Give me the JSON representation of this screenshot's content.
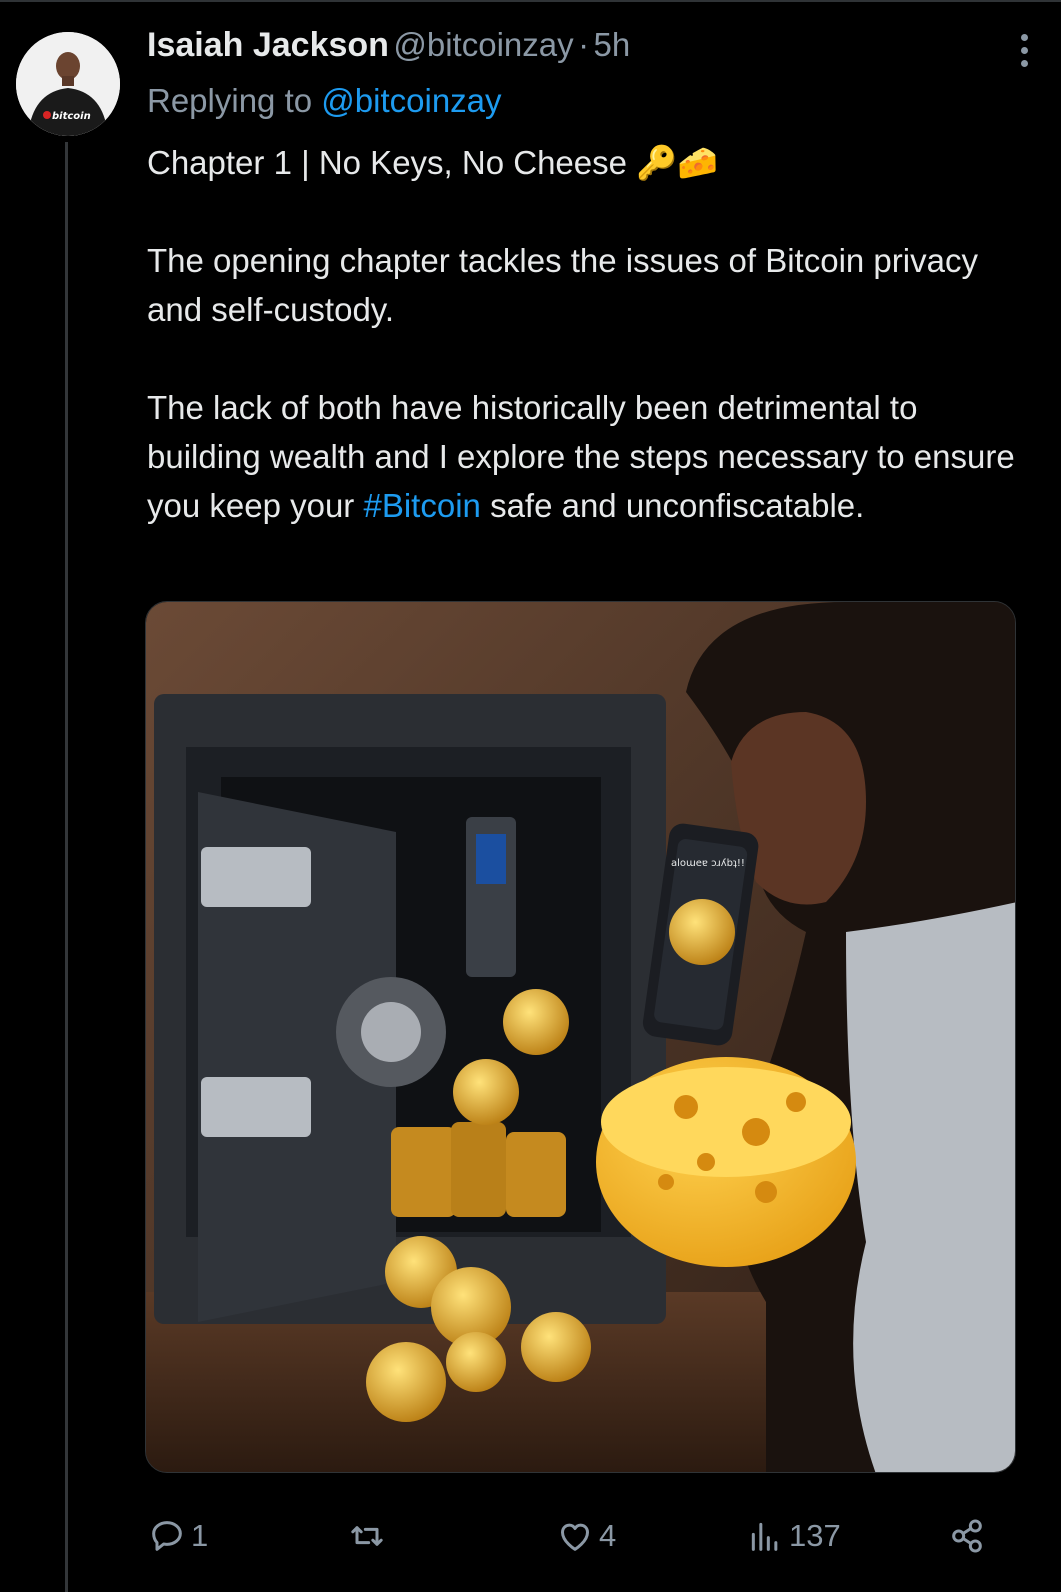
{
  "tweet": {
    "author_name": "Isaiah Jackson",
    "author_handle": "@bitcoinzay",
    "separator": "·",
    "time_ago": "5h",
    "reply_prefix": "Replying to",
    "reply_to": "@bitcoinzay",
    "title_line": "Chapter 1 | No Keys, No Cheese",
    "title_emojis": "🔑🧀",
    "para1": "The opening chapter tackles the issues of Bitcoin privacy and self-custody.",
    "para2_before": "The lack of both have historically been detrimental to building wealth and I explore the steps necessary to ensure you keep your",
    "para2_hashtag": "#Bitcoin",
    "para2_after": "safe and unconfiscatable."
  },
  "avatar": {
    "shirt_text": "bitcoin"
  },
  "media": {
    "phone_text": "aloɯeɐ ɔɹʎbʇ!!"
  },
  "actions": {
    "replies": "1",
    "reposts": "",
    "likes": "4",
    "views": "137"
  },
  "colors": {
    "background": "#000000",
    "text": "#e7e9ea",
    "secondary": "#8b98a5",
    "link": "#1d9bf0"
  }
}
